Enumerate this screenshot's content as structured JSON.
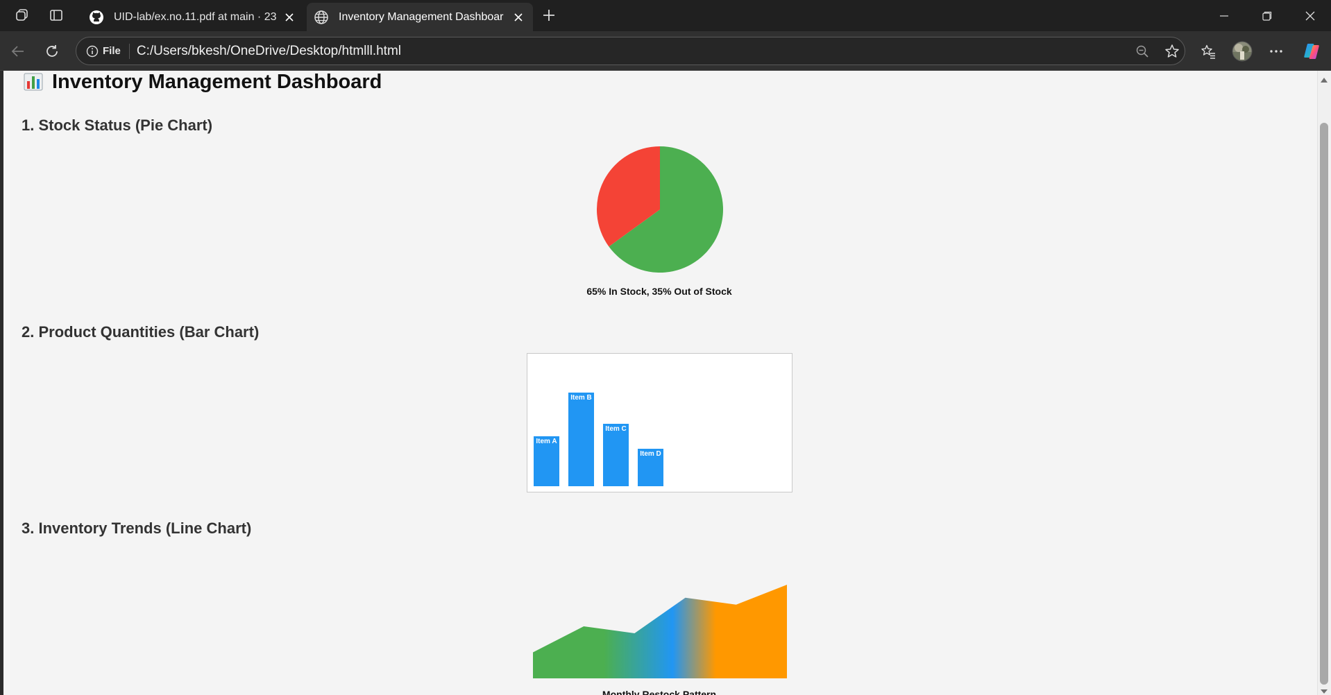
{
  "browser": {
    "tabs": [
      {
        "title": "UID-lab/ex.no.11.pdf at main · 23(",
        "icon": "github-icon",
        "active": false
      },
      {
        "title": "Inventory Management Dashboar",
        "icon": "globe-icon",
        "active": true
      }
    ],
    "address": {
      "chip_label": "File",
      "url": "C:/Users/bkesh/OneDrive/Desktop/htmlll.html"
    }
  },
  "page": {
    "title": "Inventory Management Dashboard",
    "sections": [
      {
        "heading": "1. Stock Status (Pie Chart)",
        "caption": "65% In Stock, 35% Out of Stock"
      },
      {
        "heading": "2. Product Quantities (Bar Chart)"
      },
      {
        "heading": "3. Inventory Trends (Line Chart)",
        "caption": "Monthly Restock Pattern"
      }
    ]
  },
  "chart_data": [
    {
      "type": "pie",
      "labels": [
        "In Stock",
        "Out of Stock"
      ],
      "values": [
        65,
        35
      ],
      "colors": [
        "#4caf50",
        "#f44336"
      ]
    },
    {
      "type": "bar",
      "categories": [
        "Item A",
        "Item B",
        "Item C",
        "Item D"
      ],
      "values": [
        60,
        113,
        75,
        45
      ],
      "ylim": [
        0,
        160
      ],
      "color": "#2196f3"
    },
    {
      "type": "area",
      "x": [
        0,
        1,
        2,
        3,
        4,
        5
      ],
      "values": [
        30,
        60,
        52,
        93,
        85,
        108
      ],
      "ylim": [
        0,
        108
      ],
      "gradient": [
        "#4caf50",
        "#2196f3",
        "#ff9800"
      ]
    }
  ]
}
